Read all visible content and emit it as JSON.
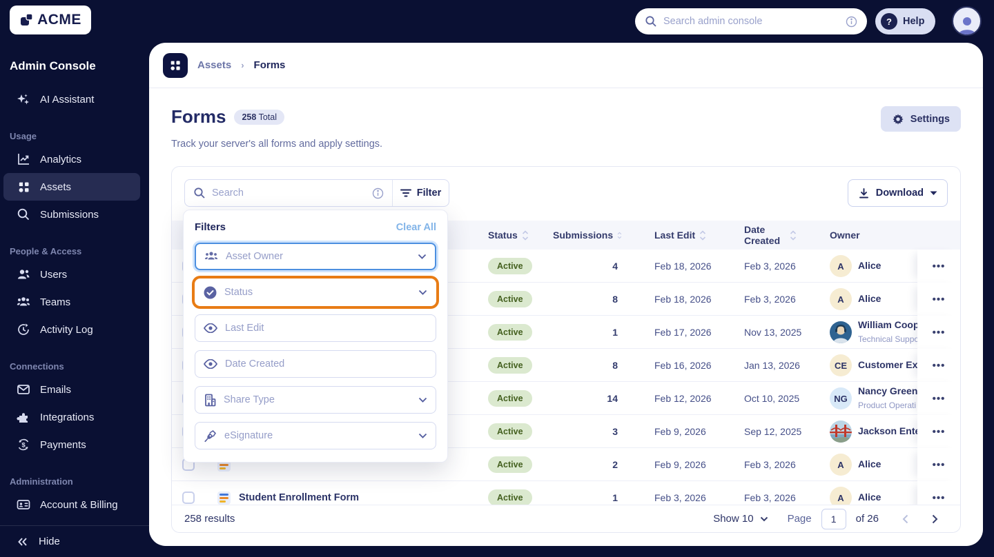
{
  "topbar": {
    "logo_text": "ACME",
    "search_placeholder": "Search admin console",
    "help_label": "Help"
  },
  "sidebar": {
    "title": "Admin Console",
    "assistant_label": "AI Assistant",
    "sections": [
      {
        "label": "Usage",
        "items": [
          {
            "label": "Analytics"
          },
          {
            "label": "Assets",
            "active": true
          },
          {
            "label": "Submissions"
          }
        ]
      },
      {
        "label": "People & Access",
        "items": [
          {
            "label": "Users"
          },
          {
            "label": "Teams"
          },
          {
            "label": "Activity Log"
          }
        ]
      },
      {
        "label": "Connections",
        "items": [
          {
            "label": "Emails"
          },
          {
            "label": "Integrations"
          },
          {
            "label": "Payments"
          }
        ]
      },
      {
        "label": "Administration",
        "items": [
          {
            "label": "Account & Billing"
          }
        ]
      }
    ],
    "hide_label": "Hide"
  },
  "breadcrumb": {
    "parent": "Assets",
    "current": "Forms"
  },
  "page": {
    "title": "Forms",
    "total_count": "258",
    "total_suffix": "Total",
    "subtitle": "Track your server's all forms and apply settings.",
    "settings_label": "Settings"
  },
  "toolbar": {
    "search_placeholder": "Search",
    "filter_label": "Filter",
    "download_label": "Download"
  },
  "filters": {
    "title": "Filters",
    "clear_all_label": "Clear All",
    "highlight_color": "#e87c15",
    "focus_color": "#4c8fe0",
    "fields": [
      {
        "label": "Asset Owner",
        "icon": "users-group-icon",
        "state": "focused-blue"
      },
      {
        "label": "Status",
        "icon": "check-circle-icon",
        "state": "highlighted-orange"
      },
      {
        "label": "Last Edit",
        "icon": "eye-icon",
        "state": "default"
      },
      {
        "label": "Date Created",
        "icon": "eye-icon",
        "state": "default"
      },
      {
        "label": "Share Type",
        "icon": "building-icon",
        "state": "default"
      },
      {
        "label": "eSignature",
        "icon": "signature-pen-icon",
        "state": "default"
      }
    ]
  },
  "table": {
    "headers": {
      "status": "Status",
      "submissions": "Submissions",
      "last_edit": "Last Edit",
      "date_created": "Date Created",
      "owner": "Owner"
    },
    "status_colors": {
      "bg": "#dbe9cf",
      "text": "#44601f"
    },
    "rows": [
      {
        "name": "",
        "status": "Active",
        "submissions": "4",
        "last_edit": "Feb 18, 2026",
        "date_created": "Feb 3, 2026",
        "owner": {
          "name": "Alice",
          "initials": "A",
          "subtitle": ""
        }
      },
      {
        "name": "",
        "status": "Active",
        "submissions": "8",
        "last_edit": "Feb 18, 2026",
        "date_created": "Feb 3, 2026",
        "owner": {
          "name": "Alice",
          "initials": "A",
          "subtitle": ""
        }
      },
      {
        "name": "",
        "status": "Active",
        "submissions": "1",
        "last_edit": "Feb 17, 2026",
        "date_created": "Nov 13, 2025",
        "owner": {
          "name": "William Coope",
          "initials": "",
          "subtitle": "Technical Suppo"
        }
      },
      {
        "name": "",
        "status": "Active",
        "submissions": "8",
        "last_edit": "Feb 16, 2026",
        "date_created": "Jan 13, 2026",
        "owner": {
          "name": "Customer Exp",
          "initials": "CE",
          "subtitle": ""
        }
      },
      {
        "name": "",
        "status": "Active",
        "submissions": "14",
        "last_edit": "Feb 12, 2026",
        "date_created": "Oct 10, 2025",
        "owner": {
          "name": "Nancy Green",
          "initials": "NG",
          "subtitle": "Product Operati"
        }
      },
      {
        "name": "",
        "status": "Active",
        "submissions": "3",
        "last_edit": "Feb 9, 2026",
        "date_created": "Sep 12, 2025",
        "owner": {
          "name": "Jackson Enter",
          "initials": "",
          "subtitle": ""
        }
      },
      {
        "name": "",
        "status": "Active",
        "submissions": "2",
        "last_edit": "Feb 9, 2026",
        "date_created": "Feb 3, 2026",
        "owner": {
          "name": "Alice",
          "initials": "A",
          "subtitle": ""
        }
      },
      {
        "name": "Student Enrollment Form",
        "status": "Active",
        "submissions": "1",
        "last_edit": "Feb 3, 2026",
        "date_created": "Feb 3, 2026",
        "owner": {
          "name": "Alice",
          "initials": "A",
          "subtitle": ""
        }
      }
    ]
  },
  "footer": {
    "results": "258 results",
    "show_label": "Show 10",
    "page_label": "Page",
    "page_value": "1",
    "of_label": "of 26"
  }
}
